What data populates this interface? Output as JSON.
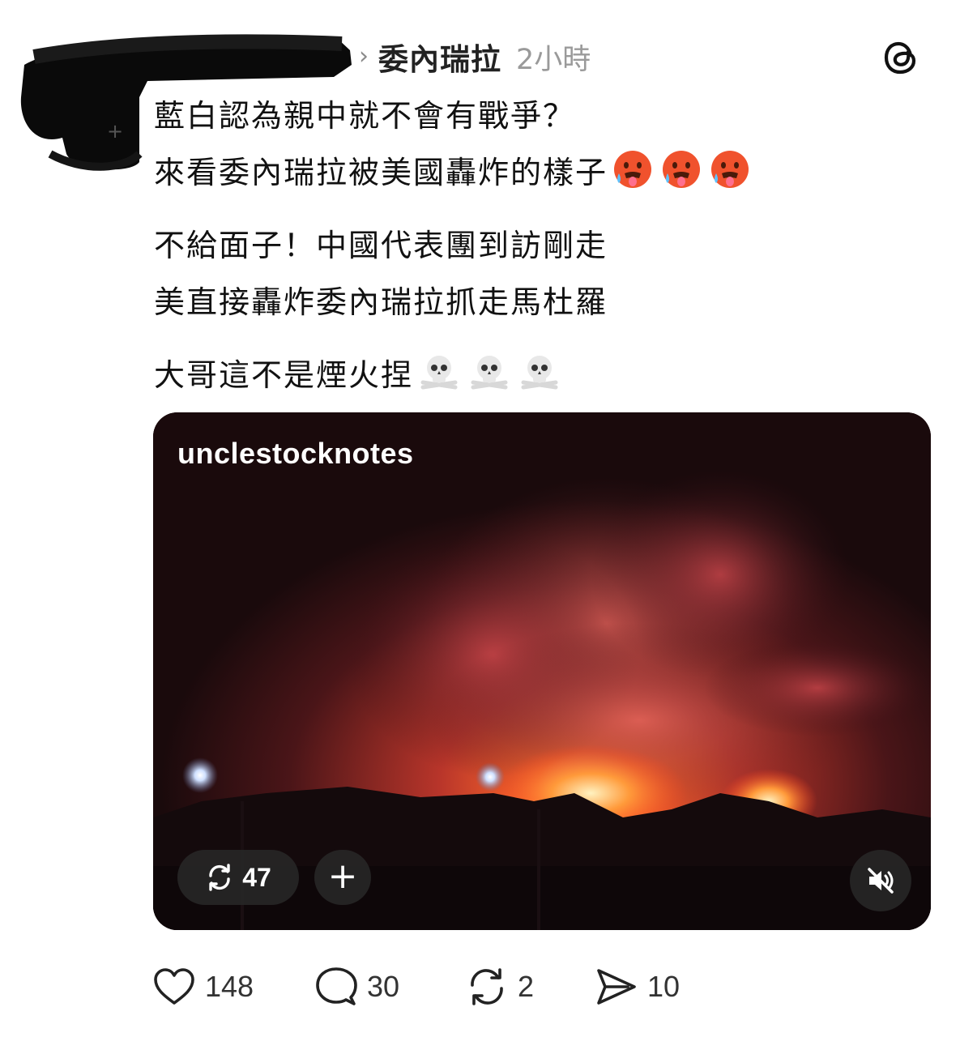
{
  "header": {
    "topic": "委內瑞拉",
    "time": "2小時"
  },
  "post": {
    "lines": [
      "藍白認為親中就不會有戰爭？",
      "來看委內瑞拉被美國轟炸的樣子",
      "不給面子！中國代表團到訪剛走",
      "美直接轟炸委內瑞拉抓走馬杜羅",
      "大哥這不是煙火捏"
    ],
    "line2_emoji": "hot-face",
    "line5_emoji": "skull-and-crossbones"
  },
  "media": {
    "watermark": "unclestocknotes",
    "repost_count": "47",
    "add_label": "+"
  },
  "actions": {
    "likes": "148",
    "replies": "30",
    "reposts": "2",
    "shares": "10"
  },
  "colors": {
    "text": "#111111",
    "muted": "#9a9a9a",
    "fire": "#ff5a2a",
    "overlay_pill": "#282828"
  }
}
